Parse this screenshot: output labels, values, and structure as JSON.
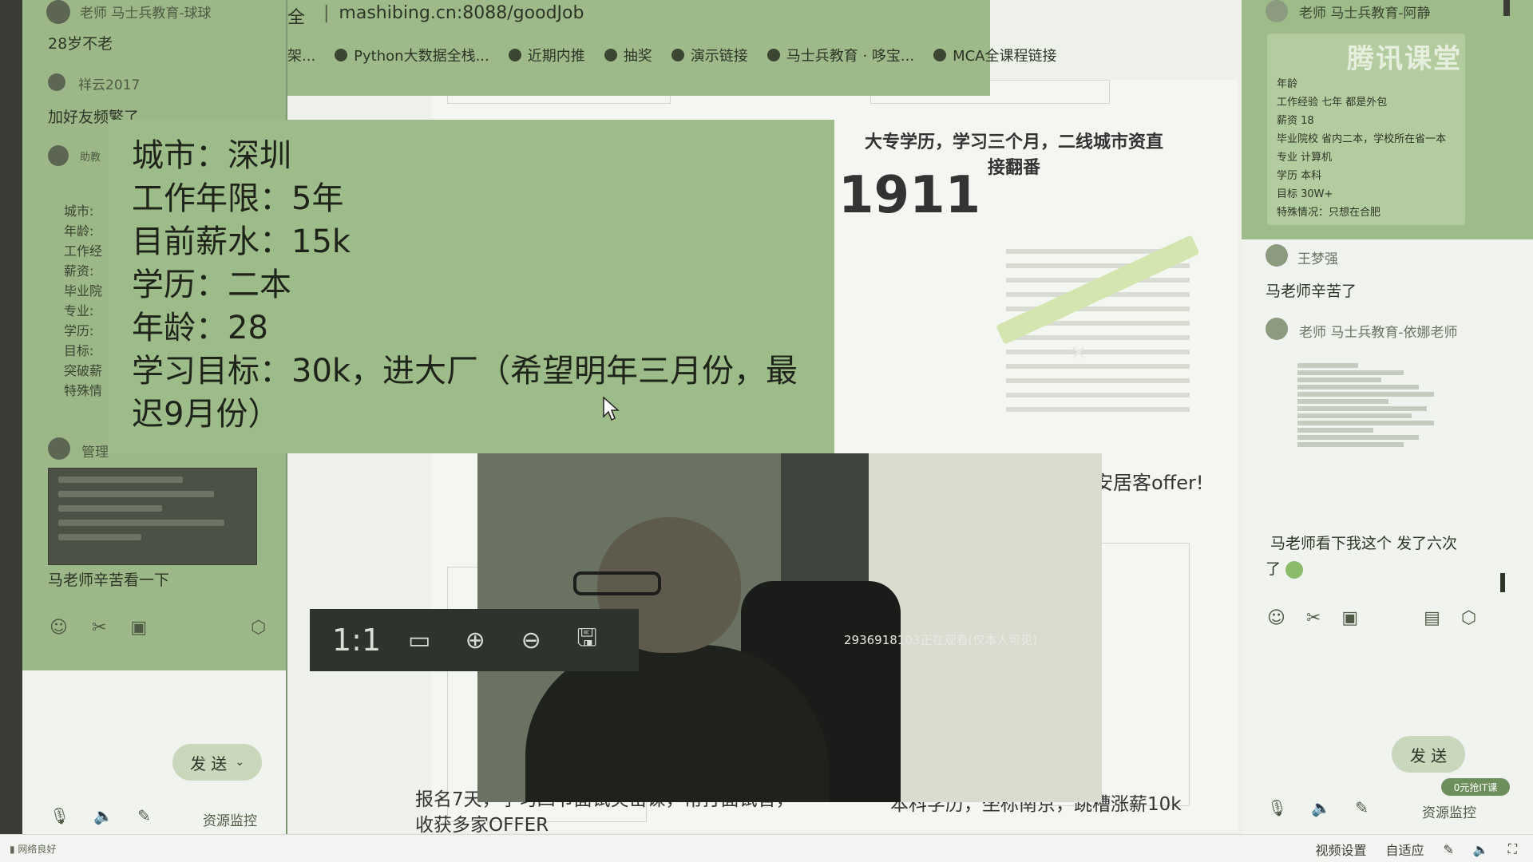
{
  "left_chat": {
    "top_sender": "老师 马士兵教育-球球",
    "msg1": "28岁不老",
    "sender2": "祥云2017",
    "msg2": "加好友频繁了",
    "sender3": "助教",
    "labels": [
      "城市:",
      "年龄:",
      "工作经",
      "薪资:",
      "毕业院",
      "专业:",
      "学历:",
      "目标:",
      "突破薪",
      "特殊情"
    ],
    "sender4": "管理",
    "msg4": "马老师辛苦看一下",
    "send_label": "发 送",
    "resource_monitor": "资源监控"
  },
  "browser": {
    "url": "mashibing.cn:8088/goodJob",
    "url_prefix": "全",
    "bookmarks": [
      "架...",
      "Python大数据全栈...",
      "近期内推",
      "抽奖",
      "演示链接",
      "马士兵教育 · 哆宝...",
      "MCA全课程链接"
    ]
  },
  "slide": {
    "title_line1": "大专学历，学习三个月，二线城市",
    "title_line2": "接翻番",
    "title_suffix": "资直",
    "big_number": "1911",
    "offer_text": "安居客offer!",
    "caption_left": "报名7天，学习四节面试突击课，常打面试官，收获多家OFFER",
    "caption_right": "本科学历，坐标南京，跳槽涨薪10k"
  },
  "info_box": {
    "lines": [
      "城市：深圳",
      "工作年限：5年",
      "目前薪水：15k",
      "学历：二本",
      "年龄：28",
      "学习目标：30k，进大厂（希望明年三月份，最迟9月份）"
    ]
  },
  "video": {
    "watch_text": "2936918103正在观看(仅本人可见)",
    "toolbar": {
      "ratio": "1:1"
    }
  },
  "right_chat": {
    "sender1": "老师 马士兵教育-阿静",
    "tencent_logo": "腾讯课堂",
    "card_lines": [
      "年龄",
      "工作经验 七年 都是外包",
      "薪资 18",
      "毕业院校 省内二本，学校所在省一本",
      "专业 计算机",
      "学历 本科",
      "目标 30W+",
      "特殊情况：只想在合肥"
    ],
    "sender2": "王梦强",
    "msg2": "马老师辛苦了",
    "sender3": "老师 马士兵教育-依娜老师",
    "msg4_line1": "马老师看下我这个 发了六次",
    "msg4_line2": "了",
    "send_label": "发 送",
    "resource_monitor": "资源监控",
    "promo": "0元抢IT课"
  },
  "status_bar": {
    "left": "网络良好",
    "video_settings": "视频设置",
    "adaptive": "自适应"
  }
}
